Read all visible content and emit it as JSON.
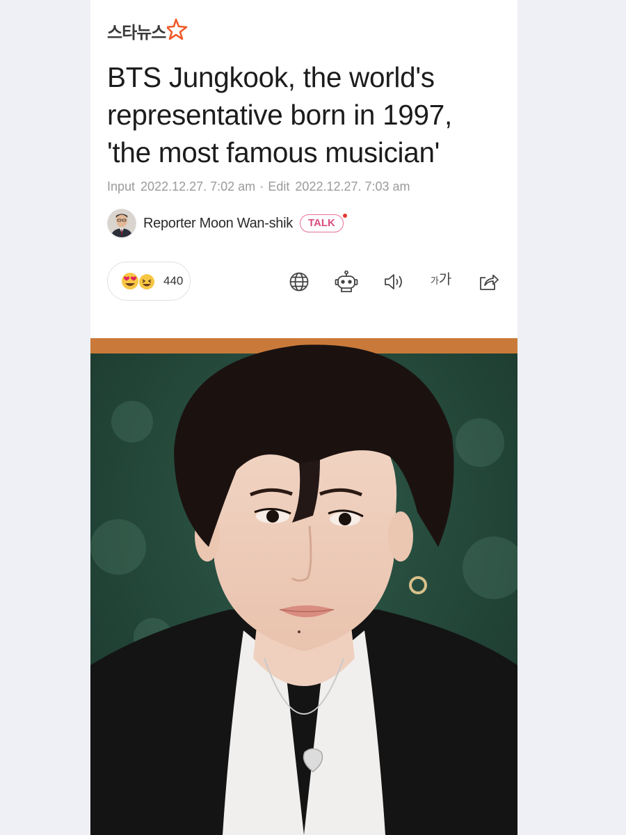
{
  "publisher": {
    "name": "스타뉴스",
    "logo_icon": "star-logo-icon"
  },
  "headline": {
    "line1": "BTS Jungkook, the world's",
    "line2": "representative born in 1997,",
    "line3": "'the most famous musician'"
  },
  "meta": {
    "input_label": "Input",
    "input_time": "2022.12.27. 7:02 am",
    "edit_label": "Edit",
    "edit_time": "2022.12.27. 7:03 am"
  },
  "reporter": {
    "name": "Reporter Moon Wan-shik",
    "talk_label": "TALK"
  },
  "reactions": {
    "count": "440",
    "emojis": [
      "heart-eyes-emoji",
      "laughing-emoji"
    ]
  },
  "toolbar": {
    "icons": [
      "globe-icon",
      "robot-icon",
      "speaker-icon",
      "font-size-icon",
      "share-icon"
    ],
    "font_small": "가",
    "font_big": "가"
  },
  "colors": {
    "talk_accent": "#d94b80",
    "logo_accent": "#f05a28",
    "page_bg": "#eef0f5"
  }
}
